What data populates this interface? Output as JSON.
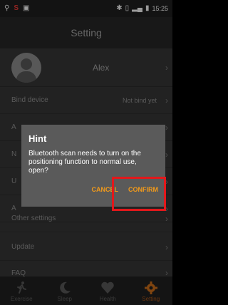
{
  "status_bar": {
    "left_icons": [
      "usb-icon",
      "s-app-icon",
      "image-icon"
    ],
    "right_icons": [
      "bluetooth-icon",
      "vibrate-icon",
      "signal-icon",
      "battery-icon"
    ],
    "time": "15:25"
  },
  "header": {
    "title": "Setting"
  },
  "profile": {
    "name": "Alex"
  },
  "settings": {
    "bind_device": {
      "label": "Bind device",
      "value": "Not bind yet"
    },
    "row_3_partial": "A",
    "row_4_partial": "N",
    "row_5_partial": "U",
    "row_6_partial": "A",
    "other_settings": "Other settings",
    "update": "Update",
    "faq": "FAQ"
  },
  "dialog": {
    "title": "Hint",
    "message": "Bluetooth scan needs to turn on the positioning function to normal use, open?",
    "cancel": "CANCEL",
    "confirm": "CONFIRM"
  },
  "tabs": [
    {
      "label": "Exercise",
      "icon": "runner-icon"
    },
    {
      "label": "Sleep",
      "icon": "moon-icon"
    },
    {
      "label": "Health",
      "icon": "heart-icon"
    },
    {
      "label": "Setting",
      "icon": "gear-icon",
      "active": true
    }
  ],
  "colors": {
    "accent": "#f29a1a",
    "active_tab": "#c56a1a",
    "highlight": "#e2181b"
  }
}
